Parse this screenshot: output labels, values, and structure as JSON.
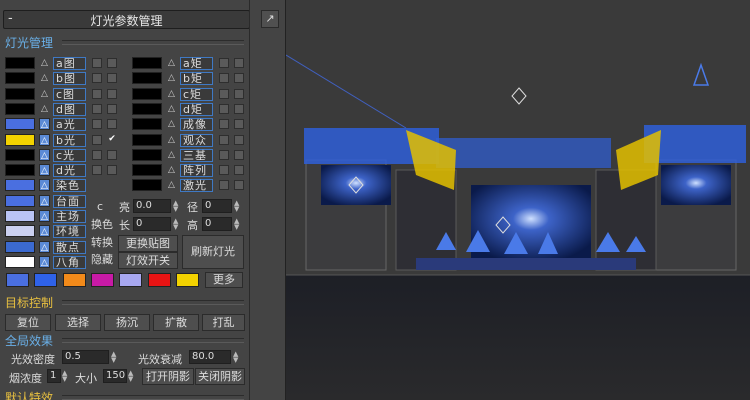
{
  "rollout": {
    "collapse": "-",
    "title": "灯光参数管理",
    "pin": "↗"
  },
  "sections": {
    "lights": "灯光管理",
    "target": "目标控制",
    "global": "全局效果",
    "default": "默认特效"
  },
  "left_lights": [
    {
      "label": "a图",
      "color": "#000000",
      "tri_on": false,
      "checked": false
    },
    {
      "label": "b图",
      "color": "#000000",
      "tri_on": false,
      "checked": false
    },
    {
      "label": "c图",
      "color": "#000000",
      "tri_on": false,
      "checked": false
    },
    {
      "label": "d图",
      "color": "#000000",
      "tri_on": false,
      "checked": false
    },
    {
      "label": "a光",
      "color": "#4a6fe0",
      "tri_on": true,
      "checked": false
    },
    {
      "label": "b光",
      "color": "#f3d200",
      "tri_on": true,
      "checked": true
    },
    {
      "label": "c光",
      "color": "#000000",
      "tri_on": true,
      "checked": false
    },
    {
      "label": "d光",
      "color": "#000000",
      "tri_on": true,
      "checked": false
    },
    {
      "label": "染色",
      "color": "#4a6fe0",
      "tri_on": true
    },
    {
      "label": "台面",
      "color": "#4a6fe0",
      "tri_on": true
    },
    {
      "label": "主场",
      "color": "#b9c4f5",
      "tri_on": true
    },
    {
      "label": "环境",
      "color": "#cbd0f0",
      "tri_on": true
    },
    {
      "label": "散点",
      "color": "#3b6ad0",
      "tri_on": true
    },
    {
      "label": "八角",
      "color": "#ffffff",
      "tri_on": true
    }
  ],
  "right_lights": [
    {
      "label": "a矩",
      "color": "#000000"
    },
    {
      "label": "b矩",
      "color": "#000000"
    },
    {
      "label": "c矩",
      "color": "#000000"
    },
    {
      "label": "d矩",
      "color": "#000000"
    },
    {
      "label": "成像",
      "color": "#000000"
    },
    {
      "label": "观众",
      "color": "#000000"
    },
    {
      "label": "三基",
      "color": "#000000"
    },
    {
      "label": "阵列",
      "color": "#000000"
    },
    {
      "label": "激光",
      "color": "#000000"
    }
  ],
  "params": {
    "c_label": "c",
    "bright_label": "亮",
    "bright_value": "0.0",
    "radius_label": "径",
    "radius_value": "0",
    "length_label": "长",
    "length_value": "0",
    "height_label": "高",
    "height_value": "0"
  },
  "buttons": {
    "change_color": "换色",
    "convert": "转换",
    "hide": "隐藏",
    "swap_map": "更换贴图",
    "effect_toggle": "灯效开关",
    "refresh": "刷新灯光",
    "more": "更多",
    "reset": "复位",
    "select": "选择",
    "sweep": "扬沉",
    "spread": "扩散",
    "shuffle": "打乱",
    "shadow_on": "打开阴影",
    "shadow_off": "关闭阴影"
  },
  "palette": [
    "#4a6fe0",
    "#2f62e8",
    "#f28a1a",
    "#c81aa6",
    "#a8a8f0",
    "#e81414",
    "#f3d200"
  ],
  "global": {
    "density_label": "光效密度",
    "density_value": "0.5",
    "decay_label": "光效衰减",
    "decay_value": "80.0",
    "smoke_label": "烟浓度",
    "smoke_value": "1",
    "size_label": "大小",
    "size_value": "150"
  }
}
